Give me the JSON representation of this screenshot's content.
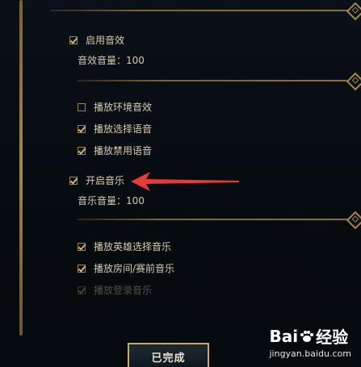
{
  "sounds": {
    "enable_sound_effects": {
      "label": "启用音效",
      "checked": true
    },
    "sfx_volume": "音效音量：100",
    "options": [
      {
        "label": "播放环境音效",
        "checked": false
      },
      {
        "label": "播放选择语音",
        "checked": true
      },
      {
        "label": "播放禁用语音",
        "checked": true
      }
    ]
  },
  "music": {
    "enable_music": {
      "label": "开启音乐",
      "checked": true
    },
    "music_volume": "音乐音量：100",
    "options": [
      {
        "label": "播放英雄选择音乐",
        "checked": true
      },
      {
        "label": "播放房间/赛前音乐",
        "checked": true
      },
      {
        "label": "播放登录音乐",
        "checked": true
      }
    ]
  },
  "footer": {
    "done_label": "已完成"
  },
  "watermark": {
    "brand_left": "Bai",
    "brand_right": "经验",
    "url": "jingyan.baidu.com"
  },
  "colors": {
    "accent_gold": "#a2844c",
    "arrow_red": "#e33a3a",
    "text": "#d6cbb1"
  }
}
